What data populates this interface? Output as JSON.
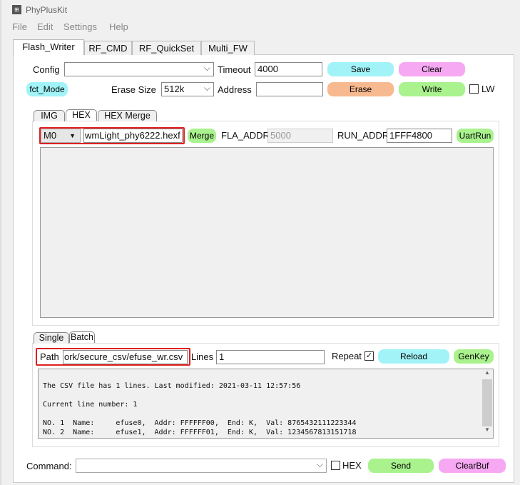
{
  "window": {
    "title": "PhyPlusKit"
  },
  "menu": [
    "File",
    "Edit",
    "Settings",
    "Help"
  ],
  "tabs": [
    "Flash_Writer",
    "RF_CMD",
    "RF_QuickSet",
    "Multi_FW"
  ],
  "config": {
    "label": "Config",
    "value": "",
    "timeout_label": "Timeout",
    "timeout": "4000",
    "save": "Save",
    "clear": "Clear"
  },
  "erase": {
    "fct_mode": "fct_Mode",
    "size_label": "Erase Size",
    "size": "512k",
    "address_label": "Address",
    "address": "",
    "erase": "Erase",
    "write": "Write",
    "lw": "LW"
  },
  "subtabs": [
    "IMG",
    "HEX",
    "HEX Merge"
  ],
  "hex": {
    "mode": "M0",
    "file": "wmLight_phy6222.hexf",
    "merge": "Merge",
    "fla_label": "FLA_ADDR",
    "fla": "5000",
    "run_label": "RUN_ADDR",
    "run": "1FFF4800",
    "uartrun": "UartRun"
  },
  "batchtabs": [
    "Single",
    "Batch"
  ],
  "batch": {
    "path_label": "Path",
    "path": "ork/secure_csv/efuse_wr.csv",
    "lines_label": "Lines",
    "lines": "1",
    "repeat_label": "Repeat",
    "repeat_checked": true,
    "reload": "Reload",
    "genkey": "GenKey"
  },
  "log": [
    "The CSV file has 1 lines. Last modified: 2021-03-11 12:57:56",
    "",
    "Current line number: 1",
    "",
    "NO. 1  Name:     efuse0,  Addr: FFFFFF00,  End: K,  Val: 8765432111223344",
    "NO. 2  Name:     efuse1,  Addr: FFFFFF01,  End: K,  Val: 1234567813151718"
  ],
  "command": {
    "label": "Command:",
    "value": "",
    "hex_label": "HEX",
    "send": "Send",
    "clearbuf": "ClearBuf"
  },
  "colors": {
    "cyan": "#a2f3f7",
    "pink": "#f6a8f2",
    "orange": "#f7b98f",
    "green": "#a9f28e",
    "highlight": "#e02020"
  }
}
